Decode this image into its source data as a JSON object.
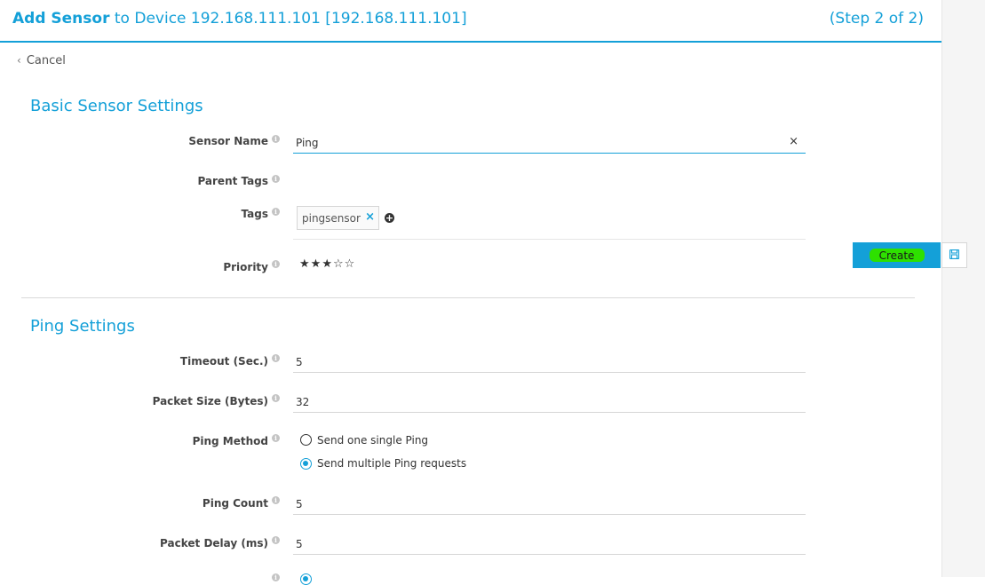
{
  "header": {
    "title_bold": "Add Sensor",
    "title_rest": " to Device 192.168.111.101 [192.168.111.101]",
    "step": "(Step 2 of 2)"
  },
  "nav": {
    "cancel_label": "Cancel"
  },
  "basic": {
    "section_title": "Basic Sensor Settings",
    "sensor_name_label": "Sensor Name",
    "sensor_name_value": "Ping",
    "parent_tags_label": "Parent Tags",
    "tags_label": "Tags",
    "tag_value": "pingsensor",
    "priority_label": "Priority",
    "priority_value": 3,
    "priority_max": 5
  },
  "actions": {
    "create_label": "Create"
  },
  "ping": {
    "section_title": "Ping Settings",
    "timeout_label": "Timeout (Sec.)",
    "timeout_value": "5",
    "packet_size_label": "Packet Size (Bytes)",
    "packet_size_value": "32",
    "method_label": "Ping Method",
    "method_options": [
      "Send one single Ping",
      "Send multiple Ping requests"
    ],
    "method_selected": 1,
    "count_label": "Ping Count",
    "count_value": "5",
    "delay_label": "Packet Delay (ms)",
    "delay_value": "5"
  },
  "colors": {
    "accent": "#14a0d8",
    "highlight": "#2ee000"
  }
}
